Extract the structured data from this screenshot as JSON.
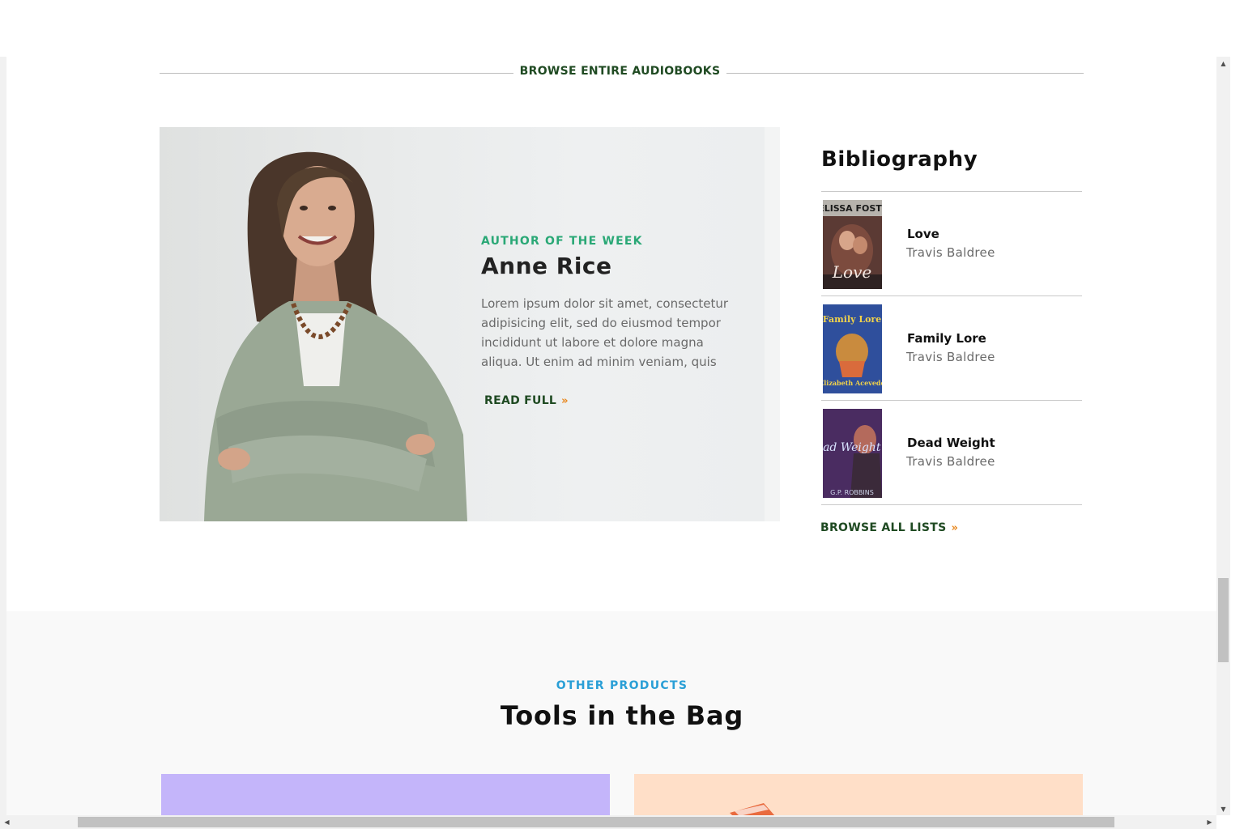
{
  "browse_heading": "BROWSE ENTIRE AUDIOBOOKS",
  "author": {
    "kicker": "AUTHOR OF THE WEEK",
    "name": "Anne Rice",
    "bio": "Lorem ipsum dolor sit amet, consectetur adipisicing elit, sed do eiusmod tempor incididunt ut labore et dolore magna aliqua. Ut enim ad minim veniam, quis",
    "read_full_label": "READ FULL",
    "chevron": "»"
  },
  "bibliography": {
    "title": "Bibliography",
    "books": [
      {
        "title": "Love",
        "author": "Travis Baldree",
        "cover_text_top": "MELISSA FOSTER",
        "cover_text_main": "Love"
      },
      {
        "title": "Family Lore",
        "author": "Travis Baldree",
        "cover_text_top": "Family Lore",
        "cover_text_main": "Elizabeth Acevedo"
      },
      {
        "title": "Dead Weight",
        "author": "Travis Baldree",
        "cover_text_top": "Dead Weight",
        "cover_text_main": "G.P. ROBBINS"
      }
    ],
    "browse_all_label": "BROWSE ALL LISTS"
  },
  "products": {
    "kicker": "OTHER PRODUCTS",
    "title": "Tools in the Bag"
  },
  "colors": {
    "dark_green": "#1f4a22",
    "accent_green": "#2aa876",
    "accent_blue": "#2a9fd6",
    "accent_orange": "#e8861a",
    "card_purple": "#c4b5fa",
    "card_peach": "#ffdfc8"
  },
  "scrollbar_icons": {
    "up": "▲",
    "down": "▼",
    "left": "◀",
    "right": "▶"
  }
}
